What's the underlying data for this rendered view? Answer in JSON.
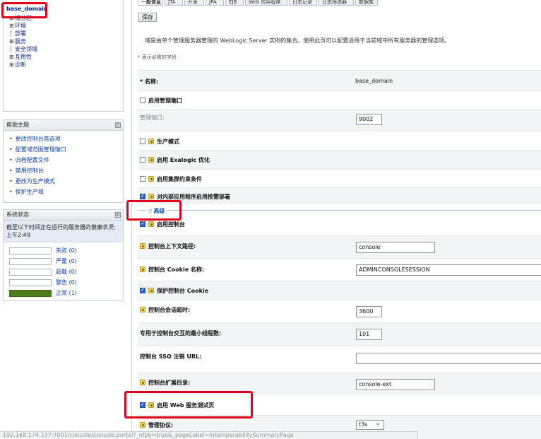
{
  "tree": {
    "root": "base_domain",
    "items": [
      {
        "exp": "⊞",
        "label": "域分区"
      },
      {
        "exp": "⊞",
        "label": "环境"
      },
      {
        "exp": "",
        "label": "部署"
      },
      {
        "exp": "⊞",
        "label": "服务"
      },
      {
        "exp": "",
        "label": "安全领域"
      },
      {
        "exp": "⊞",
        "label": "互用性"
      },
      {
        "exp": "⊞",
        "label": "诊断"
      }
    ]
  },
  "help": {
    "title": "帮助主题",
    "toggle": "⊟",
    "items": [
      "更改控制台首选项",
      "配置域范围管理端口",
      "归档配置文件",
      "禁用控制台",
      "更改为生产模式",
      "保护生产域"
    ]
  },
  "health": {
    "title": "系统状态",
    "toggle": "⊟",
    "text": "截至以下时间正在运行的服务器的健康状况: 上午2:49",
    "rows": [
      {
        "label": "失败 (0)",
        "state": "empty"
      },
      {
        "label": "严重 (0)",
        "state": "empty"
      },
      {
        "label": "超载 (0)",
        "state": "empty"
      },
      {
        "label": "警告 (0)",
        "state": "empty"
      },
      {
        "label": "正常 (1)",
        "state": "ok"
      }
    ]
  },
  "tabs": [
    "一般信息",
    "JTA",
    "开发",
    "JPA",
    "EJB",
    "Web 应用程序",
    "日志记录",
    "日志筛选器",
    "数据库"
  ],
  "save_label": "保存",
  "description": "域是由单个管理服务器管理的 WebLogic Server 实例的集合。使用此页可以配置适用于当前域中所有服务器的管理选项。",
  "required_note": "* 表示必需的字段",
  "fields": {
    "name_label": "* 名称:",
    "name_value": "base_domain",
    "admin_port_enabled": "启用管理端口",
    "admin_port_label": "管理端口:",
    "admin_port_value": "9002",
    "production_mode": "生产模式",
    "exalogic": "启用 Exalogic 优化",
    "cluster_constraints": "启用集群约束条件",
    "on_demand_deploy": "对内部应用程序启用按需部署"
  },
  "advanced_label": "高级",
  "advanced": {
    "console_enabled": "启用控制台",
    "context_path_label": "控制台上下文路径:",
    "context_path_value": "console",
    "cookie_label": "控制台 Cookie 名称:",
    "cookie_value": "ADMINCONSOLESESSION",
    "protect_cookie": "保护控制台 Cookie",
    "session_timeout_label": "控制台会话超时:",
    "session_timeout_value": "3600",
    "min_threads_label": "专用于控制台交互的最小线程数:",
    "min_threads_value": "101",
    "sso_label": "控制台 SSO 注销 URL:",
    "sso_value": "",
    "ext_dir_label": "控制台扩展目录:",
    "ext_dir_value": "console-ext",
    "web_service_test": "启用 Web 服务测试页",
    "mgmt_protocol_label": "管理协议:",
    "mgmt_protocol_value": "t3s"
  },
  "status_url": "192.168.174.137:7001/console/console.portal?_nfpb=true&_pageLabel=InteroperabilitySummaryPage"
}
